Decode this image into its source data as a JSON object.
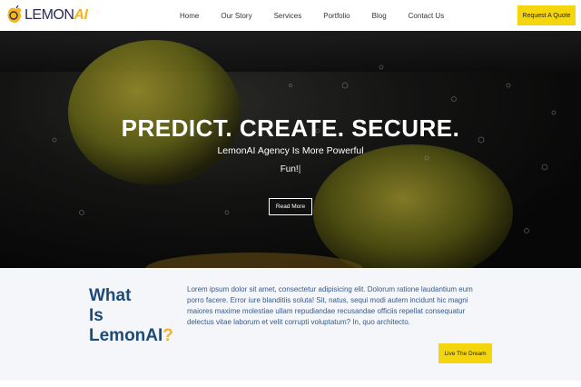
{
  "brand": {
    "logo_prefix": "LEMON",
    "logo_suffix": "AI"
  },
  "nav": {
    "items": [
      {
        "label": "Home"
      },
      {
        "label": "Our Story"
      },
      {
        "label": "Services"
      },
      {
        "label": "Portfolio"
      },
      {
        "label": "Blog"
      },
      {
        "label": "Contact Us"
      }
    ],
    "cta_label": "Request A Quote"
  },
  "hero": {
    "title": "PREDICT. CREATE. SECURE.",
    "subtitle": "LemonAI Agency Is More Powerful",
    "typed_text": "Fun!",
    "typed_cursor": "|",
    "button_label": "Read More"
  },
  "about": {
    "heading_line1": "What",
    "heading_line2": "Is",
    "heading_line3": "LemonAI",
    "heading_mark": "?",
    "body": "Lorem ipsum dolor sit amet, consectetur adipisicing elit. Dolorum ratione laudantium eum porro facere. Error iure blanditiis soluta! Sit, natus, sequi modi autem incidunt hic magni maiores maxime molestiae ullam repudiandae recusandae officiis repellat consequatur delectus vitae laborum et velit corrupti voluptatum? In, quo architecto.",
    "button_label": "Live The Dream"
  },
  "colors": {
    "accent_yellow": "#f5d50b",
    "heading_blue": "#1d4a78",
    "body_blue": "#3a5a86",
    "logo_orange": "#f5b51b"
  }
}
